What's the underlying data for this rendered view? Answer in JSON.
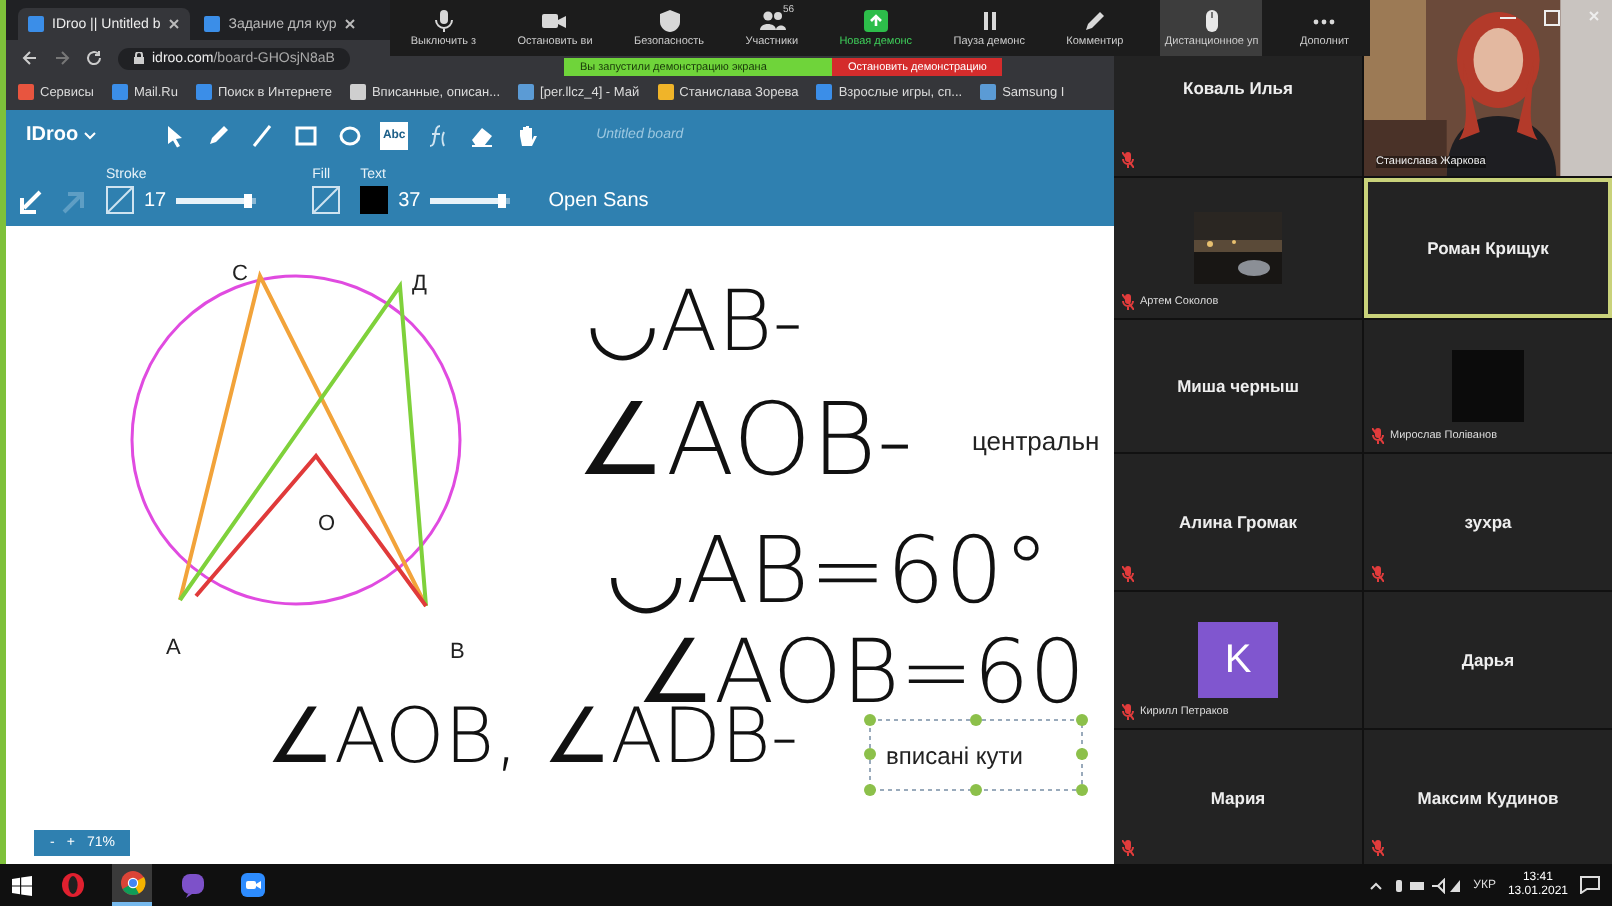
{
  "browser": {
    "tabs": [
      {
        "title": "IDroo || Untitled b",
        "selected": true
      },
      {
        "title": "Задание для кур",
        "selected": false
      }
    ],
    "url_host": "idroo.com",
    "url_path": "/board-GHOsjN8aB",
    "bookmarks": [
      {
        "label": "Сервисы",
        "kind": "apps"
      },
      {
        "label": "Mail.Ru",
        "kind": "mail"
      },
      {
        "label": "Поиск в Интернете",
        "kind": "search"
      },
      {
        "label": "Вписанные, описан...",
        "kind": "page"
      },
      {
        "label": "[per.llcz_4] - Май",
        "kind": "doc"
      },
      {
        "label": "Станислава Зорева",
        "kind": "star"
      },
      {
        "label": "Взрослые игры, сп...",
        "kind": "game"
      },
      {
        "label": "Samsung I",
        "kind": "doc"
      }
    ]
  },
  "zoom_toolbar": {
    "items": [
      {
        "kind": "mic",
        "label": "Выключить з",
        "selected": false
      },
      {
        "kind": "video",
        "label": "Остановить ви",
        "selected": false
      },
      {
        "kind": "security",
        "label": "Безопасность",
        "selected": false
      },
      {
        "kind": "participants",
        "label": "Участники",
        "badge": "56",
        "selected": false
      },
      {
        "kind": "share",
        "label": "Новая демонс",
        "selected": false
      },
      {
        "kind": "pause",
        "label": "Пауза демонс",
        "selected": false
      },
      {
        "kind": "annotate",
        "label": "Комментир",
        "selected": false
      },
      {
        "kind": "remote",
        "label": "Дистанционное уп",
        "selected": true
      },
      {
        "kind": "more",
        "label": "Дополнит",
        "selected": false
      }
    ]
  },
  "share_banner": {
    "status": "Вы запустили демонстрацию экрана",
    "stop": "Остановить демонстрацию"
  },
  "idroo": {
    "logo": "IDroo",
    "tools": [
      {
        "kind": "pointer",
        "selected": false
      },
      {
        "kind": "pen",
        "selected": false
      },
      {
        "kind": "line",
        "selected": false
      },
      {
        "kind": "rect",
        "selected": false
      },
      {
        "kind": "ellipse",
        "selected": false
      },
      {
        "kind": "text",
        "label": "Abc",
        "selected": true
      },
      {
        "kind": "formula",
        "selected": false
      },
      {
        "kind": "eraser",
        "selected": false
      },
      {
        "kind": "hand",
        "selected": false
      }
    ],
    "board_title": "Untitled board",
    "stroke": {
      "label": "Stroke",
      "size": "17",
      "level": 0.9
    },
    "fill": {
      "label": "Fill"
    },
    "text": {
      "label": "Text",
      "size": "37",
      "level": 0.9,
      "font": "Open Sans"
    },
    "zoom": {
      "minus": "-",
      "plus": "+",
      "percent": "71%"
    }
  },
  "board": {
    "points": [
      {
        "label": "C"
      },
      {
        "label": "Д"
      },
      {
        "label": "O"
      },
      {
        "label": "A"
      },
      {
        "label": "B"
      }
    ],
    "notes": [
      {
        "text": "◡AB-"
      },
      {
        "text": "∠AOB-"
      },
      {
        "text": "◡AB=60°"
      },
      {
        "text": "∠AOB=60"
      },
      {
        "text": "∠AOB, ∠ADB-"
      }
    ],
    "typed": "центральн",
    "text_box": "вписані кути"
  },
  "gallery": {
    "tiles": [
      {
        "kind": "name",
        "name": "Коваль Илья",
        "muted": true,
        "speaking": false
      },
      {
        "kind": "video",
        "name": "Станислава Жаркова",
        "muted": false,
        "speaking": false
      },
      {
        "kind": "thumbnail",
        "name": "Артем Соколов",
        "muted": true,
        "speaking": false
      },
      {
        "kind": "name",
        "name": "Роман Крищук",
        "muted": false,
        "speaking": true
      },
      {
        "kind": "name",
        "name": "Миша черныш",
        "muted": false,
        "speaking": false
      },
      {
        "kind": "blank",
        "name": "Мирослав Поліванов",
        "muted": true,
        "speaking": false
      },
      {
        "kind": "name",
        "name": "Алина Громак",
        "muted": true,
        "speaking": false
      },
      {
        "kind": "name",
        "name": "зухра",
        "muted": true,
        "speaking": false
      },
      {
        "kind": "avatar",
        "name": "Кирилл Петраков",
        "letter": "K",
        "muted": true,
        "speaking": false
      },
      {
        "kind": "name",
        "name": "Дарья",
        "muted": false,
        "speaking": false
      },
      {
        "kind": "name",
        "name": "Мария",
        "muted": true,
        "speaking": false
      },
      {
        "kind": "name",
        "name": "Максим Кудинов",
        "muted": true,
        "speaking": false
      }
    ]
  },
  "taskbar": {
    "apps": [
      {
        "kind": "opera",
        "selected": false
      },
      {
        "kind": "chrome",
        "selected": true
      },
      {
        "kind": "viber",
        "selected": false
      },
      {
        "kind": "zoom",
        "selected": false
      }
    ],
    "language": "УКР",
    "time": "13:41",
    "date": "13.01.2021"
  }
}
